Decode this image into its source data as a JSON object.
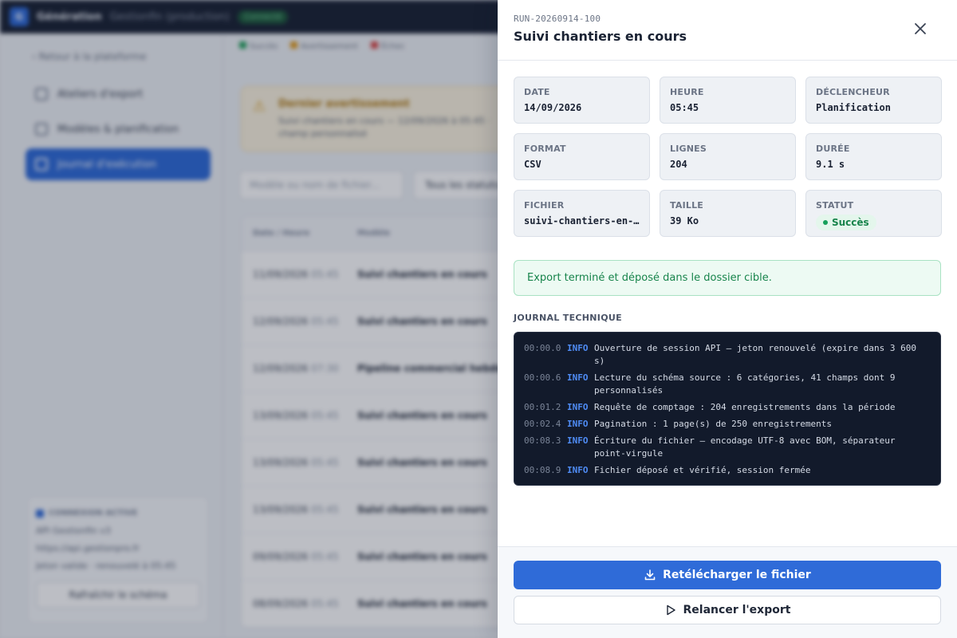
{
  "background": {
    "brand": "Génération",
    "environment": "Gestionfin (production)",
    "env_badge": "Connecté",
    "back_link": "Retour à la plateforme",
    "nav": [
      {
        "label": "Ateliers d'export"
      },
      {
        "label": "Modèles & planification"
      },
      {
        "label": "Journal d'exécution"
      }
    ],
    "legend": [
      "Succès",
      "Avertissement",
      "Échec"
    ],
    "alert_title": "Dernier avertissement",
    "alert_text": "Suivi chantiers en cours — 12/09/2026 à 05:45 · champ personnalisé",
    "search_placeholder": "Modèle ou nom de fichier...",
    "filter_label": "Tous les statuts",
    "table_headers": [
      "Date / Heure",
      "Modèle"
    ],
    "rows": [
      {
        "date": "11/09/2026",
        "time": "05:45",
        "model": "Suivi chantiers en cours"
      },
      {
        "date": "12/09/2026",
        "time": "05:45",
        "model": "Suivi chantiers en cours"
      },
      {
        "date": "12/09/2026",
        "time": "07:30",
        "model": "Pipeline commercial hebdo"
      },
      {
        "date": "13/09/2026",
        "time": "05:45",
        "model": "Suivi chantiers en cours"
      },
      {
        "date": "13/09/2026",
        "time": "05:45",
        "model": "Suivi chantiers en cours"
      },
      {
        "date": "13/09/2026",
        "time": "05:45",
        "model": "Suivi chantiers en cours"
      },
      {
        "date": "09/09/2026",
        "time": "05:45",
        "model": "Suivi chantiers en cours"
      },
      {
        "date": "08/09/2026",
        "time": "05:45",
        "model": "Suivi chantiers en cours"
      }
    ],
    "connection_title": "CONNEXION ACTIVE",
    "connection_name": "API Gestionfin v3",
    "connection_url": "https://api.gestionpro.fr",
    "connection_note": "Jeton valide · renouvelé à 05:45",
    "refresh_label": "Rafraîchir le schéma"
  },
  "drawer": {
    "run_id": "RUN-20260914-100",
    "title": "Suivi chantiers en cours",
    "close_icon": "close-icon",
    "cards": [
      {
        "label": "Date",
        "value": "14/09/2026"
      },
      {
        "label": "Heure",
        "value": "05:45"
      },
      {
        "label": "Déclencheur",
        "value": "Planification"
      },
      {
        "label": "Format",
        "value": "CSV"
      },
      {
        "label": "Lignes",
        "value": "204"
      },
      {
        "label": "Durée",
        "value": "9.1 s"
      },
      {
        "label": "Fichier",
        "value": "suivi-chantiers-en-cours.csv"
      },
      {
        "label": "Taille",
        "value": "39 Ko"
      },
      {
        "label": "Statut",
        "value": "Succès"
      }
    ],
    "status_color": "#17a05b",
    "success_message": "Export terminé et déposé dans le dossier cible.",
    "log_title": "JOURNAL TECHNIQUE",
    "log": [
      {
        "ts": "00:00.0",
        "level": "INFO",
        "msg": "Ouverture de session API — jeton renouvelé (expire dans 3 600 s)"
      },
      {
        "ts": "00:00.6",
        "level": "INFO",
        "msg": "Lecture du schéma source : 6 catégories, 41 champs dont 9 personnalisés"
      },
      {
        "ts": "00:01.2",
        "level": "INFO",
        "msg": "Requête de comptage : 204 enregistrements dans la période"
      },
      {
        "ts": "00:02.4",
        "level": "INFO",
        "msg": "Pagination : 1 page(s) de 250 enregistrements"
      },
      {
        "ts": "00:08.3",
        "level": "INFO",
        "msg": "Écriture du fichier — encodage UTF-8 avec BOM, séparateur point-virgule"
      },
      {
        "ts": "00:08.9",
        "level": "INFO",
        "msg": "Fichier déposé et vérifié, session fermée"
      }
    ],
    "primary_button": "Retélécharger le fichier",
    "secondary_button": "Relancer l'export",
    "accent": "#2f6bd8"
  }
}
